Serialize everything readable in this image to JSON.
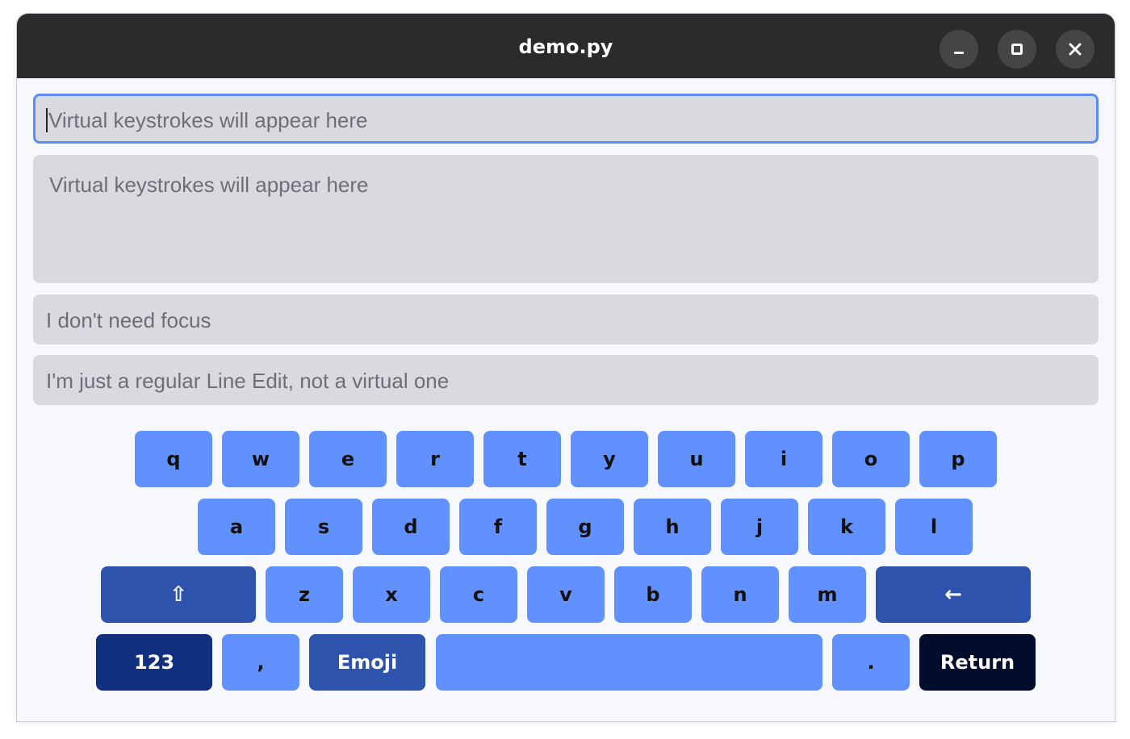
{
  "window": {
    "title": "demo.py",
    "controls": [
      "minimize",
      "maximize",
      "close"
    ]
  },
  "fields": {
    "focused_input": {
      "placeholder": "Virtual keystrokes will appear here",
      "value": ""
    },
    "text_area": {
      "placeholder": "Virtual keystrokes will appear here",
      "value": ""
    },
    "no_focus_input": {
      "placeholder": "I don't need focus",
      "value": ""
    },
    "regular_input": {
      "placeholder": "I'm just a regular Line Edit, not a virtual one",
      "value": ""
    }
  },
  "keyboard": {
    "row1": [
      "q",
      "w",
      "e",
      "r",
      "t",
      "y",
      "u",
      "i",
      "o",
      "p"
    ],
    "row2": [
      "a",
      "s",
      "d",
      "f",
      "g",
      "h",
      "j",
      "k",
      "l"
    ],
    "row3": {
      "shift": "⇧",
      "letters": [
        "z",
        "x",
        "c",
        "v",
        "b",
        "n",
        "m"
      ],
      "backspace": "←"
    },
    "row4": {
      "numbers": "123",
      "comma": ",",
      "emoji": "Emoji",
      "space": "",
      "period": ".",
      "return": "Return"
    }
  },
  "colors": {
    "key_light": "#6190ff",
    "key_dark": "#2d53ad",
    "key_navy": "#113080",
    "key_black": "#020c2c",
    "focus_border": "#5b8cf5",
    "titlebar": "#2b2b2b"
  },
  "icons": {
    "minimize": "minimize-icon",
    "maximize": "maximize-icon",
    "close": "close-icon"
  }
}
